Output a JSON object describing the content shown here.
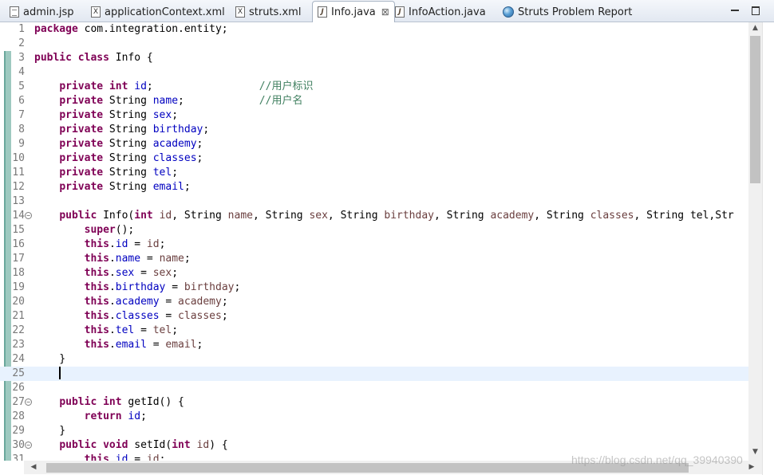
{
  "tabs": [
    {
      "label": "admin.jsp",
      "icon": "jsp-file-icon"
    },
    {
      "label": "applicationContext.xml",
      "icon": "xml-file-icon"
    },
    {
      "label": "struts.xml",
      "icon": "xml-file-icon"
    },
    {
      "label": "Info.java",
      "icon": "java-file-icon",
      "active": true
    },
    {
      "label": "InfoAction.java",
      "icon": "java-file-icon"
    },
    {
      "label": "Struts Problem Report",
      "icon": "globe-icon"
    }
  ],
  "close_glyph": "⊠",
  "editor": {
    "current_line": 25,
    "lines": [
      {
        "n": "1",
        "code": "<span class='kw'>package</span> com.integration.entity;"
      },
      {
        "n": "2",
        "code": ""
      },
      {
        "n": "3",
        "code": "<span class='kw'>public</span> <span class='kw'>class</span> Info {"
      },
      {
        "n": "4",
        "code": ""
      },
      {
        "n": "5",
        "code": "    <span class='kw'>private</span> <span class='kw'>int</span> <span class='fld'>id</span>;                 <span class='cmt'>//用户标识</span>"
      },
      {
        "n": "6",
        "code": "    <span class='kw'>private</span> String <span class='fld'>name</span>;            <span class='cmt'>//用户名</span>"
      },
      {
        "n": "7",
        "code": "    <span class='kw'>private</span> String <span class='fld'>sex</span>;"
      },
      {
        "n": "8",
        "code": "    <span class='kw'>private</span> String <span class='fld'>birthday</span>;"
      },
      {
        "n": "9",
        "code": "    <span class='kw'>private</span> String <span class='fld'>academy</span>;"
      },
      {
        "n": "10",
        "code": "    <span class='kw'>private</span> String <span class='fld'>classes</span>;"
      },
      {
        "n": "11",
        "code": "    <span class='kw'>private</span> String <span class='fld'>tel</span>;"
      },
      {
        "n": "12",
        "code": "    <span class='kw'>private</span> String <span class='fld'>email</span>;"
      },
      {
        "n": "13",
        "code": ""
      },
      {
        "n": "14",
        "fold": true,
        "code": "    <span class='kw'>public</span> Info(<span class='kw'>int</span> <span class='param'>id</span>, String <span class='param'>name</span>, String <span class='param'>sex</span>, String <span class='param'>birthday</span>, String <span class='param'>academy</span>, String <span class='param'>classes</span>, String tel,Str"
      },
      {
        "n": "15",
        "code": "        <span class='kw'>super</span>();"
      },
      {
        "n": "16",
        "code": "        <span class='kw'>this</span>.<span class='fld'>id</span> = <span class='param'>id</span>;"
      },
      {
        "n": "17",
        "code": "        <span class='kw'>this</span>.<span class='fld'>name</span> = <span class='param'>name</span>;"
      },
      {
        "n": "18",
        "code": "        <span class='kw'>this</span>.<span class='fld'>sex</span> = <span class='param'>sex</span>;"
      },
      {
        "n": "19",
        "code": "        <span class='kw'>this</span>.<span class='fld'>birthday</span> = <span class='param'>birthday</span>;"
      },
      {
        "n": "20",
        "code": "        <span class='kw'>this</span>.<span class='fld'>academy</span> = <span class='param'>academy</span>;"
      },
      {
        "n": "21",
        "code": "        <span class='kw'>this</span>.<span class='fld'>classes</span> = <span class='param'>classes</span>;"
      },
      {
        "n": "22",
        "code": "        <span class='kw'>this</span>.<span class='fld'>tel</span> = <span class='param'>tel</span>;"
      },
      {
        "n": "23",
        "code": "        <span class='kw'>this</span>.<span class='fld'>email</span> = <span class='param'>email</span>;"
      },
      {
        "n": "24",
        "code": "    }"
      },
      {
        "n": "25",
        "code": "    <span class='caret'></span>"
      },
      {
        "n": "26",
        "code": ""
      },
      {
        "n": "27",
        "fold": true,
        "code": "    <span class='kw'>public</span> <span class='kw'>int</span> getId() {"
      },
      {
        "n": "28",
        "code": "        <span class='kw'>return</span> <span class='fld'>id</span>;"
      },
      {
        "n": "29",
        "code": "    }"
      },
      {
        "n": "30",
        "fold": true,
        "code": "    <span class='kw'>public</span> <span class='kw'>void</span> setId(<span class='kw'>int</span> <span class='param'>id</span>) {"
      },
      {
        "n": "31",
        "code": "        <span class='kw'>this</span>.<span class='fld'>id</span> = <span class='param'>id</span>;"
      }
    ]
  },
  "watermark": "https://blog.csdn.net/qq_39940390"
}
